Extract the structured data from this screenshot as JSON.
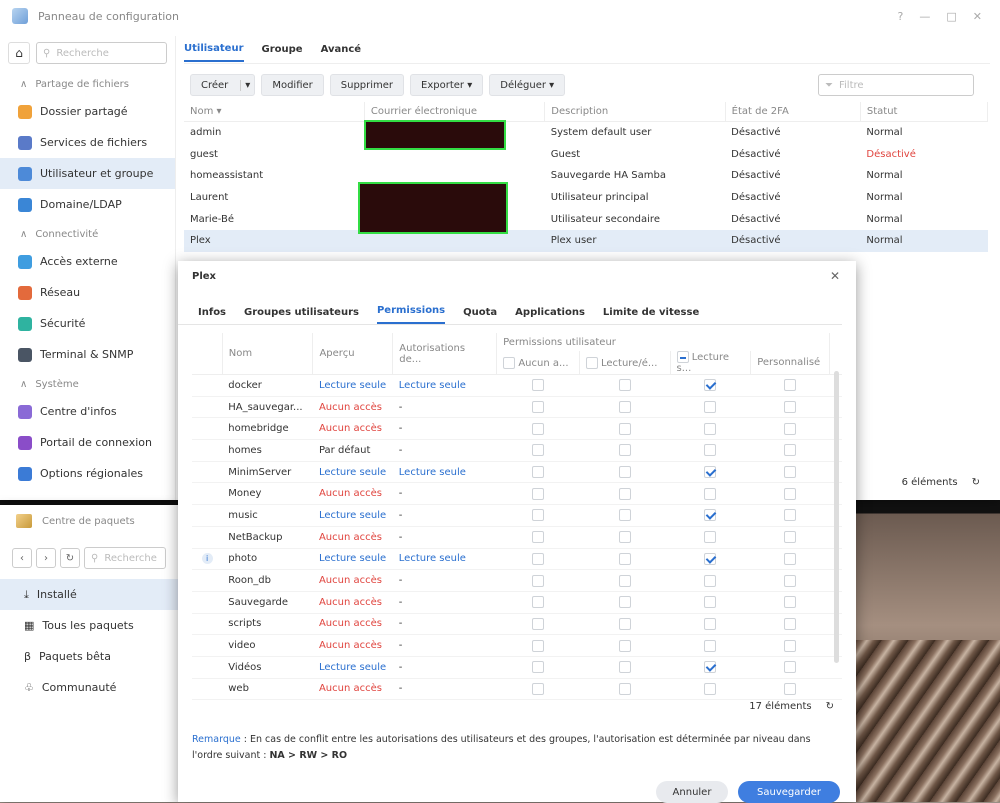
{
  "control_panel": {
    "title": "Panneau de configuration",
    "win_controls": [
      "?",
      "—",
      "□",
      "✕"
    ],
    "search_placeholder": "Recherche",
    "sections": {
      "file_sharing": "Partage de fichiers",
      "connectivity": "Connectivité",
      "system": "Système"
    },
    "nav": [
      {
        "label": "Dossier partagé",
        "icon": "folder-icon",
        "color": "#f0a23a"
      },
      {
        "label": "Services de fichiers",
        "icon": "file-services-icon",
        "color": "#5a7ac8"
      },
      {
        "label": "Utilisateur et groupe",
        "icon": "users-icon",
        "color": "#4d8ad8"
      },
      {
        "label": "Domaine/LDAP",
        "icon": "domain-icon",
        "color": "#3a86d6"
      },
      {
        "label": "Accès externe",
        "icon": "external-access-icon",
        "color": "#3f9de0"
      },
      {
        "label": "Réseau",
        "icon": "network-icon",
        "color": "#e36a3c"
      },
      {
        "label": "Sécurité",
        "icon": "shield-icon",
        "color": "#2fb3a0"
      },
      {
        "label": "Terminal & SNMP",
        "icon": "terminal-icon",
        "color": "#4a5564"
      },
      {
        "label": "Centre d'infos",
        "icon": "info-icon",
        "color": "#8a6ad6"
      },
      {
        "label": "Portail de connexion",
        "icon": "login-portal-icon",
        "color": "#8a4dc8"
      },
      {
        "label": "Options régionales",
        "icon": "regional-icon",
        "color": "#3b7bd6"
      }
    ],
    "tabs": [
      "Utilisateur",
      "Groupe",
      "Avancé"
    ],
    "toolbar": {
      "create": "Créer",
      "modify": "Modifier",
      "delete": "Supprimer",
      "export": "Exporter",
      "delegate": "Déléguer",
      "filter_placeholder": "Filtre"
    },
    "columns": [
      "Nom",
      "Courrier électronique",
      "Description",
      "État de 2FA",
      "Statut"
    ],
    "users": [
      {
        "name": "admin",
        "email": "",
        "desc": "System default user",
        "twofa": "Désactivé",
        "status": "Normal",
        "status_color": "#333"
      },
      {
        "name": "guest",
        "email": "",
        "desc": "Guest",
        "twofa": "Désactivé",
        "status": "Désactivé",
        "status_color": "#e0443e"
      },
      {
        "name": "homeassistant",
        "email": "",
        "desc": "Sauvegarde HA Samba",
        "twofa": "Désactivé",
        "status": "Normal",
        "status_color": "#333"
      },
      {
        "name": "Laurent",
        "email": "",
        "desc": "Utilisateur principal",
        "twofa": "Désactivé",
        "status": "Normal",
        "status_color": "#333"
      },
      {
        "name": "Marie-Bé",
        "email": "",
        "desc": "Utilisateur secondaire",
        "twofa": "Désactivé",
        "status": "Normal",
        "status_color": "#333"
      },
      {
        "name": "Plex",
        "email": "",
        "desc": "Plex user",
        "twofa": "Désactivé",
        "status": "Normal",
        "status_color": "#333"
      }
    ],
    "count": "6 éléments"
  },
  "package_center": {
    "title": "Centre de paquets",
    "search_placeholder": "Recherche",
    "nav": [
      {
        "label": "Installé",
        "icon": "download-icon"
      },
      {
        "label": "Tous les paquets",
        "icon": "grid-icon"
      },
      {
        "label": "Paquets bêta",
        "icon": "beta-icon"
      },
      {
        "label": "Communauté",
        "icon": "community-icon"
      }
    ]
  },
  "dialog": {
    "title": "Plex",
    "tabs": [
      "Infos",
      "Groupes utilisateurs",
      "Permissions",
      "Quota",
      "Applications",
      "Limite de vitesse"
    ],
    "columns": {
      "name": "Nom",
      "preview": "Aperçu",
      "auth": "Autorisations de...",
      "group_header": "Permissions utilisateur",
      "na": "Aucun a...",
      "rw": "Lecture/é...",
      "ro": "Lecture s...",
      "custom": "Personnalisé"
    },
    "rows": [
      {
        "name": "docker",
        "preview": "Lecture seule",
        "pcolor": "blue",
        "auth": "Lecture seule",
        "acolor": "blue",
        "perm": "ro",
        "info": false
      },
      {
        "name": "HA_sauvegar...",
        "preview": "Aucun accès",
        "pcolor": "red",
        "auth": "-",
        "acolor": "",
        "perm": "",
        "info": false
      },
      {
        "name": "homebridge",
        "preview": "Aucun accès",
        "pcolor": "red",
        "auth": "-",
        "acolor": "",
        "perm": "",
        "info": false
      },
      {
        "name": "homes",
        "preview": "Par défaut",
        "pcolor": "",
        "auth": "-",
        "acolor": "",
        "perm": "",
        "info": false
      },
      {
        "name": "MinimServer",
        "preview": "Lecture seule",
        "pcolor": "blue",
        "auth": "Lecture seule",
        "acolor": "blue",
        "perm": "ro",
        "info": false
      },
      {
        "name": "Money",
        "preview": "Aucun accès",
        "pcolor": "red",
        "auth": "-",
        "acolor": "",
        "perm": "",
        "info": false
      },
      {
        "name": "music",
        "preview": "Lecture seule",
        "pcolor": "blue",
        "auth": "-",
        "acolor": "",
        "perm": "ro",
        "info": false
      },
      {
        "name": "NetBackup",
        "preview": "Aucun accès",
        "pcolor": "red",
        "auth": "-",
        "acolor": "",
        "perm": "",
        "info": false
      },
      {
        "name": "photo",
        "preview": "Lecture seule",
        "pcolor": "blue",
        "auth": "Lecture seule",
        "acolor": "blue",
        "perm": "ro",
        "info": true
      },
      {
        "name": "Roon_db",
        "preview": "Aucun accès",
        "pcolor": "red",
        "auth": "-",
        "acolor": "",
        "perm": "",
        "info": false
      },
      {
        "name": "Sauvegarde",
        "preview": "Aucun accès",
        "pcolor": "red",
        "auth": "-",
        "acolor": "",
        "perm": "",
        "info": false
      },
      {
        "name": "scripts",
        "preview": "Aucun accès",
        "pcolor": "red",
        "auth": "-",
        "acolor": "",
        "perm": "",
        "info": false
      },
      {
        "name": "video",
        "preview": "Aucun accès",
        "pcolor": "red",
        "auth": "-",
        "acolor": "",
        "perm": "",
        "info": false
      },
      {
        "name": "Vidéos",
        "preview": "Lecture seule",
        "pcolor": "blue",
        "auth": "-",
        "acolor": "",
        "perm": "ro",
        "info": false
      },
      {
        "name": "web",
        "preview": "Aucun accès",
        "pcolor": "red",
        "auth": "-",
        "acolor": "",
        "perm": "",
        "info": false
      }
    ],
    "count": "17 éléments",
    "note_label": "Remarque",
    "note_text": " : En cas de conflit entre les autorisations des utilisateurs et des groupes, l'autorisation est déterminée par niveau dans l'ordre suivant : ",
    "note_rule": "NA > RW > RO",
    "cancel": "Annuler",
    "save": "Sauvegarder"
  }
}
